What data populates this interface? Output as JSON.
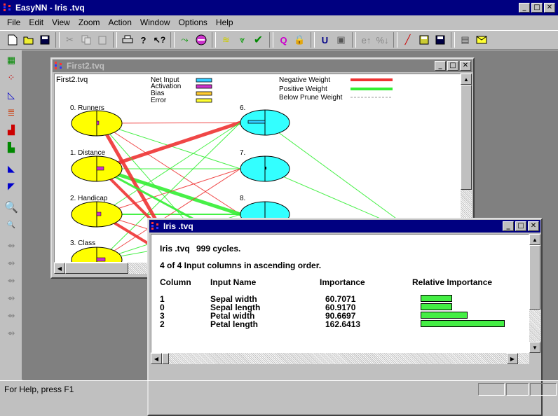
{
  "app": {
    "title": "EasyNN - Iris .tvq"
  },
  "menu": [
    "File",
    "Edit",
    "View",
    "Zoom",
    "Action",
    "Window",
    "Options",
    "Help"
  ],
  "network_window": {
    "title": "First2.tvq",
    "file_label": "First2.tvq",
    "legend_left": [
      "Net Input",
      "Activation",
      "Bias",
      "Error"
    ],
    "legend_left_colors": [
      "#33ccff",
      "#cc33cc",
      "#ffcc33",
      "#ffff33"
    ],
    "legend_right": [
      "Negative Weight",
      "Positive Weight",
      "Below Prune Weight"
    ],
    "legend_right_colors": [
      "#ee3333",
      "#33ee33",
      "#999999"
    ],
    "input_nodes": [
      "0.  Runners",
      "1.  Distance",
      "2.  Handicap",
      "3.  Class"
    ],
    "hidden_nodes": [
      "6.",
      "7.",
      "8."
    ]
  },
  "report_window": {
    "title": "Iris .tvq",
    "line1_file": "Iris .tvq",
    "line1_cycles": "999 cycles.",
    "line2": "4 of 4 Input columns in ascending order.",
    "headers": [
      "Column",
      "Input Name",
      "Importance",
      "Relative Importance"
    ],
    "rows": [
      {
        "column": "1",
        "name": "Sepal width",
        "importance": "60.7071",
        "relative": 0.373
      },
      {
        "column": "0",
        "name": "Sepal length",
        "importance": "60.9170",
        "relative": 0.375
      },
      {
        "column": "3",
        "name": "Petal width",
        "importance": "90.6697",
        "relative": 0.558
      },
      {
        "column": "2",
        "name": "Petal length",
        "importance": "162.6413",
        "relative": 1.0
      }
    ]
  },
  "status": {
    "text": "For Help, press F1"
  },
  "colors": {
    "titlebar": "#000080",
    "input_node": "#ffff00",
    "hidden_node": "#33ffff",
    "bar": "#44ee44"
  }
}
